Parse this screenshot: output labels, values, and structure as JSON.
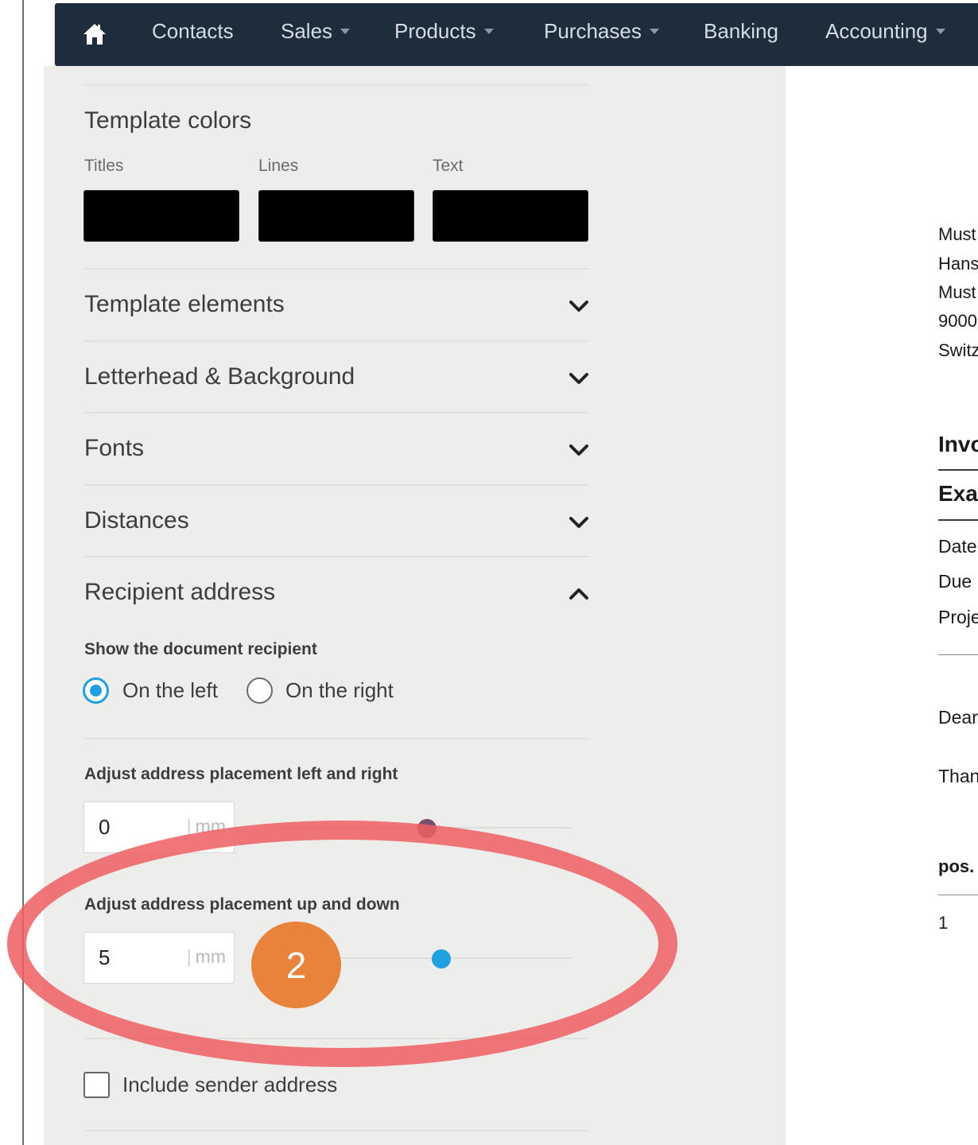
{
  "nav": {
    "items": [
      {
        "label": "Contacts",
        "dropdown": false
      },
      {
        "label": "Sales",
        "dropdown": true
      },
      {
        "label": "Products",
        "dropdown": true
      },
      {
        "label": "Purchases",
        "dropdown": true
      },
      {
        "label": "Banking",
        "dropdown": false
      },
      {
        "label": "Accounting",
        "dropdown": true
      }
    ],
    "home_icon": "home-icon"
  },
  "template_colors": {
    "title": "Template colors",
    "swatches": [
      {
        "label": "Titles",
        "color": "#000000"
      },
      {
        "label": "Lines",
        "color": "#000000"
      },
      {
        "label": "Text",
        "color": "#000000"
      }
    ]
  },
  "sections": [
    {
      "label": "Template elements",
      "expanded": false
    },
    {
      "label": "Letterhead & Background",
      "expanded": false
    },
    {
      "label": "Fonts",
      "expanded": false
    },
    {
      "label": "Distances",
      "expanded": false
    },
    {
      "label": "Recipient address",
      "expanded": true
    }
  ],
  "recipient": {
    "show_label": "Show the document recipient",
    "options": [
      {
        "label": "On the left",
        "selected": true
      },
      {
        "label": "On the right",
        "selected": false
      }
    ],
    "horizontal": {
      "label": "Adjust address placement left and right",
      "value": "0",
      "unit": "mm",
      "slider_fraction": 0.5
    },
    "vertical": {
      "label": "Adjust address placement up and down",
      "value": "5",
      "unit": "mm",
      "slider_fraction": 0.55
    },
    "include_sender": {
      "label": "Include sender address",
      "checked": false
    }
  },
  "annotation": {
    "step": "2"
  },
  "preview": {
    "address_lines": [
      "Must",
      "Hans",
      "Must",
      "9000",
      "Switz"
    ],
    "heading1": "Invo",
    "heading2": "Exa",
    "fields": [
      "Date",
      "Due",
      "Proje"
    ],
    "greeting": "Dear",
    "thanks": "Than",
    "pos_header": "pos.",
    "pos_value": "1"
  },
  "colors": {
    "navbar": "#1e2d3b",
    "accent": "#1fa0e0",
    "annotation_ring": "#ee6064",
    "annotation_badge": "#e9823a"
  }
}
